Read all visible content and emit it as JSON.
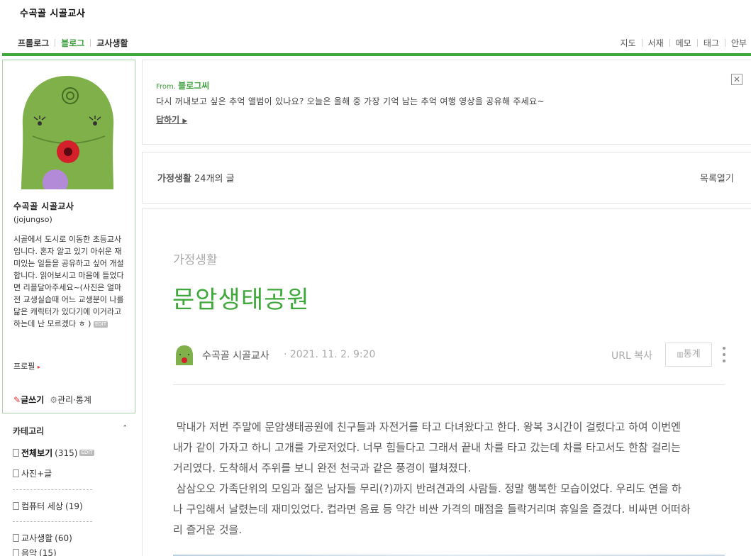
{
  "header": {
    "blog_title": "수곡골 시골교사",
    "nav_left": [
      {
        "label": "프롤로그",
        "active": false
      },
      {
        "label": "블로그",
        "active": true
      },
      {
        "label": "교사생활",
        "active": false
      }
    ],
    "nav_right": [
      "지도",
      "서재",
      "메모",
      "태그",
      "안부"
    ],
    "accent_color": "#3ea83a"
  },
  "sidebar": {
    "profile": {
      "name": "수곡골 시골교사",
      "id": "(jojungso)",
      "description": "시골에서 도시로 이동한 초등교사입니다. 혼자 알고 있기 아쉬운 재미있는 일들을 공유하고 싶어 개설합니다. 읽어보시고 마음에 들었다면 리플달아주세요~(사진은 얼마전 교생실습때 어느 교생분이 나를 닮은 캐릭터가 있다기에 이거라고 하는데 난 모르겠다 ㅎ )",
      "edit_badge": "EDIT",
      "profile_link": "프로필",
      "write_label": "글쓰기",
      "manage_label": "관리·통계"
    },
    "categories": {
      "title": "카테고리",
      "items": [
        {
          "label": "전체보기",
          "count": "(315)",
          "bold": true,
          "badge": "EDIT"
        },
        {
          "label": "사진+글",
          "count": ""
        },
        {
          "label": "컴퓨터 세상",
          "count": "(19)"
        },
        {
          "label": "교사생활",
          "count": "(60)"
        },
        {
          "label": "음악",
          "count": "(15)"
        }
      ]
    }
  },
  "notice": {
    "from_prefix": "From.",
    "from_name": "블로그씨",
    "message": "다시 꺼내보고 싶은 추억 앨범이 있나요? 오늘은 올해 중 가장 기억 남는 추억 여행 영상을 공유해 주세요~",
    "reply_label": "답하기",
    "close_glyph": "✕"
  },
  "listbar": {
    "category": "가정생활",
    "count_text": "24개의 글",
    "open_label": "목록열기"
  },
  "post": {
    "category": "가정생활",
    "title": "문암생태공원",
    "author": "수곡골 시골교사",
    "date": "· 2021. 11. 2. 9:20",
    "url_label": "URL 복사",
    "stats_label": "통계",
    "body_lines": [
      " 막내가 저번 주말에 문암생태공원에 친구들과 자전거를 타고 다녀왔다고 한다. 왕복 3시간이 걸렸다고 하여 이번엔",
      "내가 같이 가자고 하니 고개를 가로저었다. 너무 힘들다고 그래서 끝내 차를 타고 갔는데 차를 타고서도 한참 걸리는",
      "거리였다. 도착해서 주위를 보니 완전 천국과 같은 풍경이 펼쳐졌다.",
      " 삼삼오오 가족단위의 모임과 젊은 남자들 무리(?)까지 반려견과의 사람들. 정말 행복한 모습이었다. 우리도 연을 하",
      "나 구입해서 날렸는데 재미있었다. 컵라면 음료 등 약간 비싼 가격의 매점을 들락거리며 휴일을 즐겼다. 비싸면 어떠하",
      "리 즐거운 것을."
    ]
  }
}
